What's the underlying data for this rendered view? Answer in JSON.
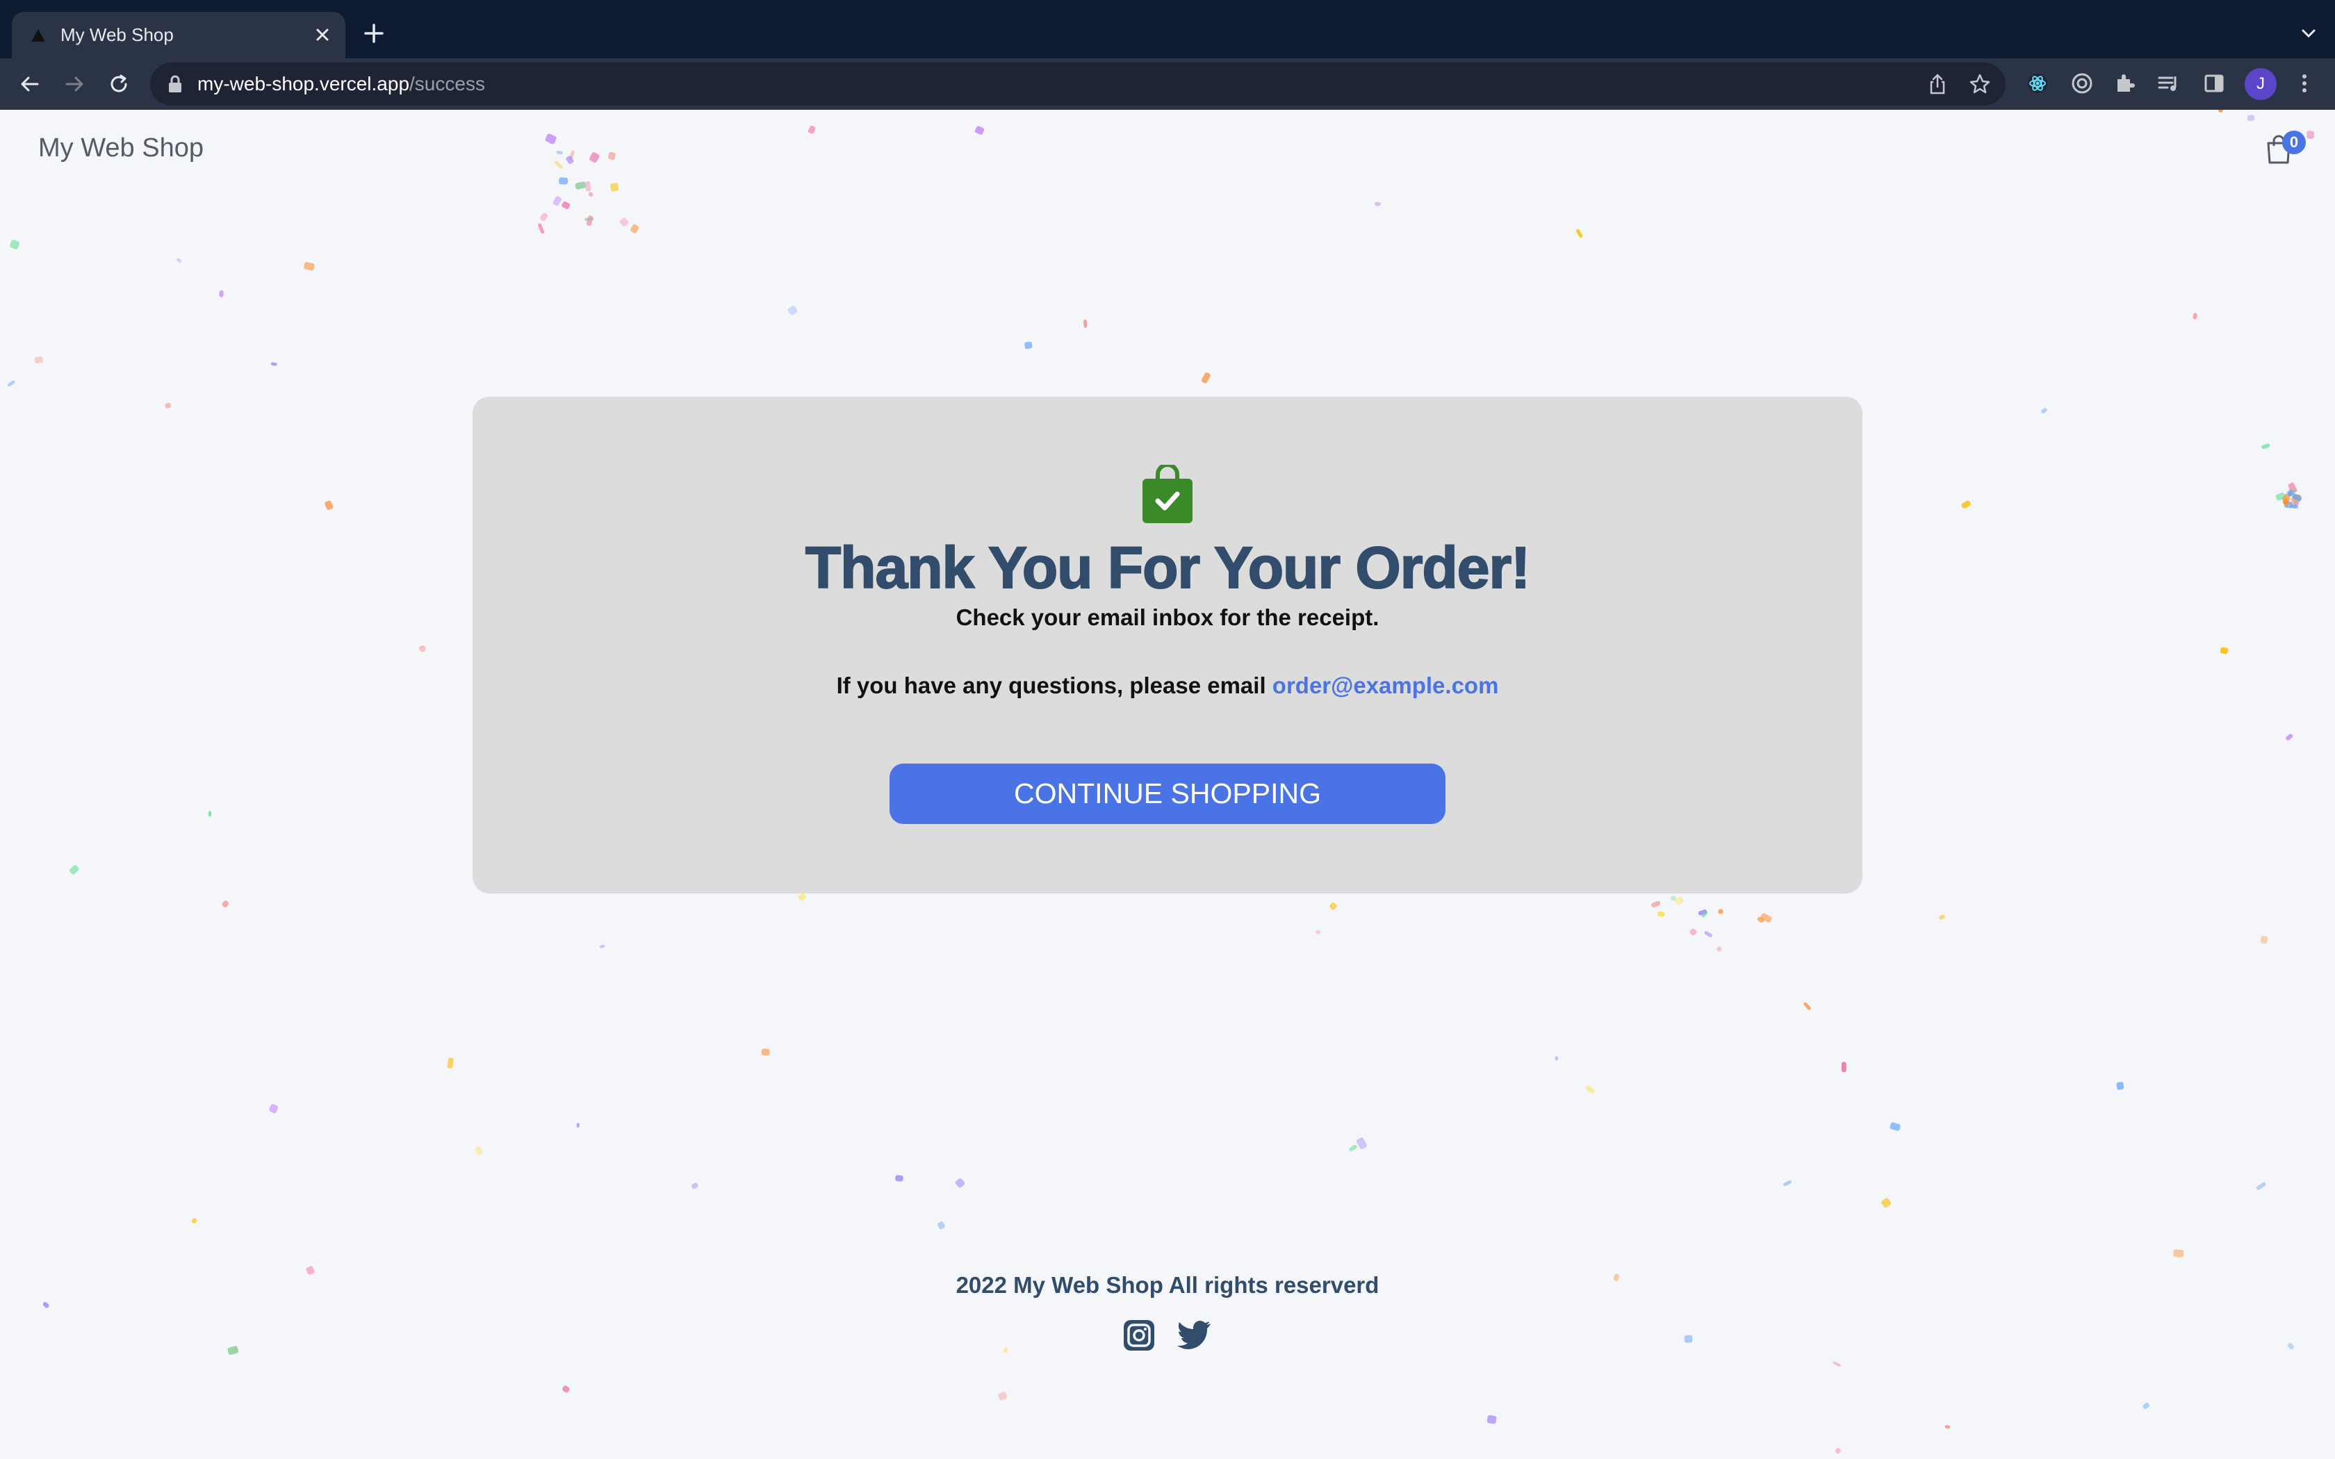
{
  "browser": {
    "tab_title": "My Web Shop",
    "url_host": "my-web-shop.vercel.app",
    "url_path": "/success",
    "profile_initial": "J"
  },
  "header": {
    "brand": "My Web Shop",
    "cart_count": "0"
  },
  "success": {
    "title": "Thank You For Your Order!",
    "subtitle": "Check your email inbox for the receipt.",
    "questions_text": "If you have any questions, please email",
    "email": "order@example.com",
    "button_label": "CONTINUE SHOPPING"
  },
  "footer": {
    "copyright": "2022 My Web Shop All rights reserverd"
  },
  "colors": {
    "accent": "#4a74e6",
    "heading": "#324c6b",
    "success_green": "#3a8a2a",
    "card_bg": "#dcdcdc"
  },
  "icons": [
    "shopping-bag-check-icon",
    "cart-icon",
    "instagram-icon",
    "twitter-icon",
    "lock-icon",
    "share-icon",
    "star-icon",
    "extensions-icon"
  ]
}
